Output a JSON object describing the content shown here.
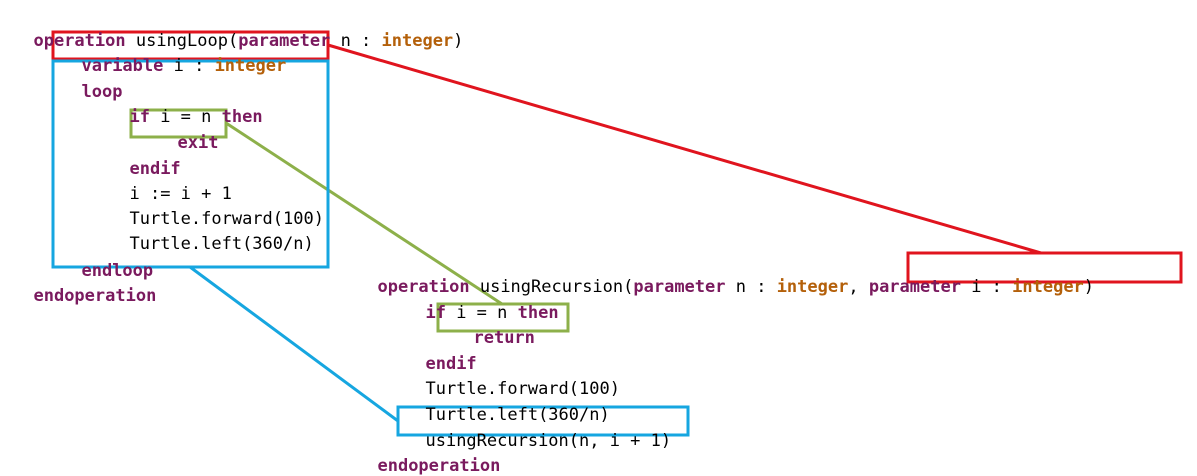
{
  "loop_block": {
    "line1": {
      "kw": "operation",
      "name": " usingLoop(",
      "param_kw": "parameter",
      "param": " n : ",
      "type": "integer",
      "end": ")"
    },
    "line2": {
      "kw": "variable",
      "rest": " i : ",
      "type": "integer"
    },
    "line3": {
      "kw": "loop"
    },
    "line4": {
      "kw1": "if",
      "cond": " i = n ",
      "kw2": "then"
    },
    "line5": {
      "kw": "exit"
    },
    "line6": {
      "kw": "endif"
    },
    "line7": {
      "text": "i := i + 1"
    },
    "line8": {
      "text": "Turtle.forward(100)"
    },
    "line9": {
      "text": "Turtle.left(360/n)"
    },
    "line10": {
      "kw": "endloop"
    },
    "line11": {
      "kw": "endoperation"
    }
  },
  "recursion_block": {
    "line1": {
      "kw": "operation",
      "name": " usingRecursion(",
      "param1_kw": "parameter",
      "param1": " n : ",
      "type1": "integer",
      "sep": ", ",
      "param2_kw": "parameter",
      "param2": " i : ",
      "type2": "integer",
      "end": ")"
    },
    "line2": {
      "kw1": "if",
      "cond": " i = n ",
      "kw2": "then"
    },
    "line3": {
      "kw": "return"
    },
    "line4": {
      "kw": "endif"
    },
    "line5": {
      "text": "Turtle.forward(100)"
    },
    "line6": {
      "text": "Turtle.left(360/n)"
    },
    "line7": {
      "text": "usingRecursion(n, i + 1)"
    },
    "line8": {
      "kw": "endoperation"
    }
  },
  "colors": {
    "keyword": "#7a1a5e",
    "type": "#b4600a",
    "variable_link": "#e0141e",
    "exit_link": "#8db04a",
    "loop_link": "#16a6e0"
  }
}
